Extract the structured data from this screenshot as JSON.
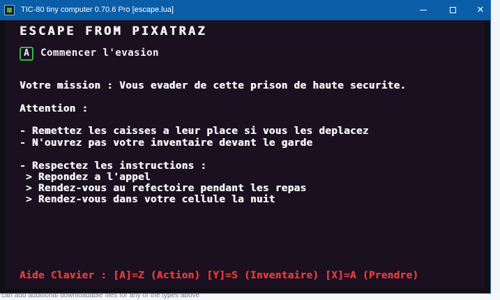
{
  "window": {
    "title": "TIC-80 tiny computer 0.70.6 Pro [escape.lua]",
    "minimize_label": "—",
    "maximize_label": "▢",
    "close_label": "✕"
  },
  "game": {
    "title": "ESCAPE FROM PIXATRAZ",
    "start_key": "A",
    "start_label": "Commencer l'evasion",
    "mission": "Votre mission : Vous evader de cette prison de haute securite.",
    "attention": "Attention :",
    "warnings": [
      "- Remettez les caisses a leur place si vous les deplacez",
      "- N'ouvrez pas votre inventaire devant le garde"
    ],
    "instructions_header": "- Respectez les instructions :",
    "instructions": [
      " > Repondez a l'appel",
      " > Rendez-vous au refectoire pendant les repas",
      " > Rendez-vous dans votre cellule la nuit"
    ],
    "keyboard_help": "Aide Clavier : [A]=Z (Action) [Y]=S (Inventaire) [X]=A (Prendre)"
  },
  "background": {
    "bottom_text": "can add additional downloadable files for any of the types above"
  },
  "colors": {
    "titlebar": "#0a5ea8",
    "screen_bg": "#1a1020",
    "text": "#f4f4f4",
    "key_border": "#39b54a",
    "help_text": "#e13a3a"
  },
  "icons": {
    "app": "tic80-app-icon",
    "minimize": "minimize-icon",
    "maximize": "maximize-icon",
    "close": "close-icon"
  }
}
